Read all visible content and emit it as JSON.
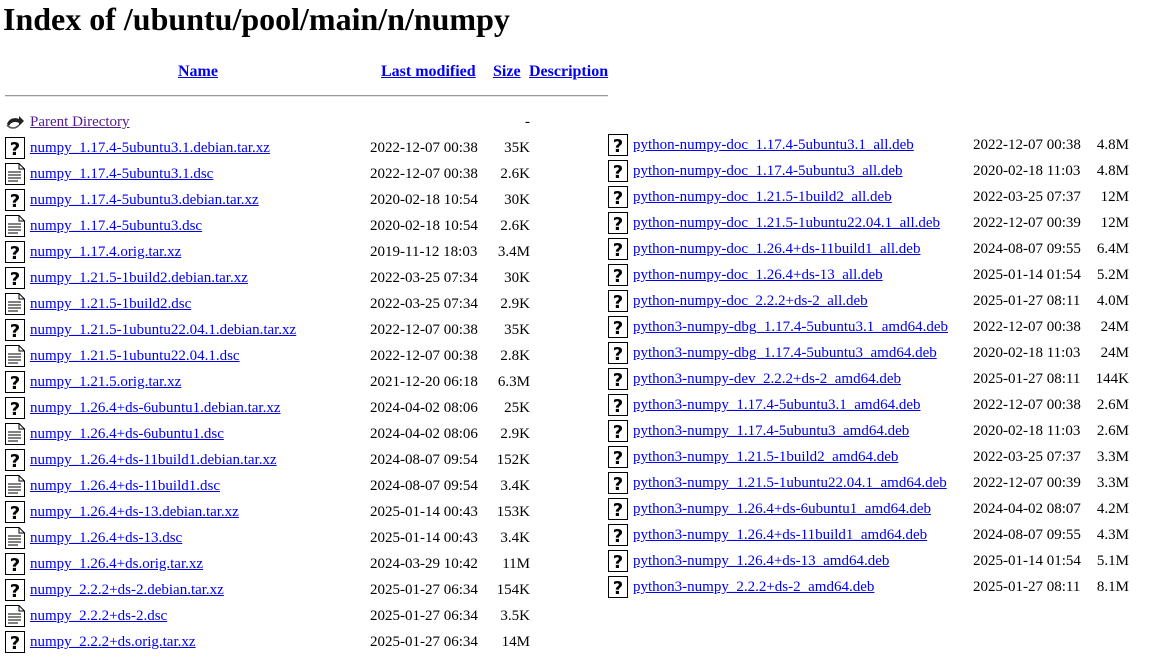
{
  "page": {
    "title": "Index of /ubuntu/pool/main/n/numpy",
    "columns": {
      "name": "Name",
      "last_modified": "Last modified",
      "size": "Size",
      "description": "Description"
    }
  },
  "parent": {
    "label": "Parent Directory",
    "size": "-",
    "icon": "back-arrow-icon"
  },
  "files_left": [
    {
      "name": "numpy_1.17.4-5ubuntu3.1.debian.tar.xz",
      "modified": "2022-12-07 00:38",
      "size": "35K",
      "icon": "unknown-icon"
    },
    {
      "name": "numpy_1.17.4-5ubuntu3.1.dsc",
      "modified": "2022-12-07 00:38",
      "size": "2.6K",
      "icon": "text-file-icon"
    },
    {
      "name": "numpy_1.17.4-5ubuntu3.debian.tar.xz",
      "modified": "2020-02-18 10:54",
      "size": "30K",
      "icon": "unknown-icon"
    },
    {
      "name": "numpy_1.17.4-5ubuntu3.dsc",
      "modified": "2020-02-18 10:54",
      "size": "2.6K",
      "icon": "text-file-icon"
    },
    {
      "name": "numpy_1.17.4.orig.tar.xz",
      "modified": "2019-11-12 18:03",
      "size": "3.4M",
      "icon": "unknown-icon"
    },
    {
      "name": "numpy_1.21.5-1build2.debian.tar.xz",
      "modified": "2022-03-25 07:34",
      "size": "30K",
      "icon": "unknown-icon"
    },
    {
      "name": "numpy_1.21.5-1build2.dsc",
      "modified": "2022-03-25 07:34",
      "size": "2.9K",
      "icon": "text-file-icon"
    },
    {
      "name": "numpy_1.21.5-1ubuntu22.04.1.debian.tar.xz",
      "modified": "2022-12-07 00:38",
      "size": "35K",
      "icon": "unknown-icon"
    },
    {
      "name": "numpy_1.21.5-1ubuntu22.04.1.dsc",
      "modified": "2022-12-07 00:38",
      "size": "2.8K",
      "icon": "text-file-icon"
    },
    {
      "name": "numpy_1.21.5.orig.tar.xz",
      "modified": "2021-12-20 06:18",
      "size": "6.3M",
      "icon": "unknown-icon"
    },
    {
      "name": "numpy_1.26.4+ds-6ubuntu1.debian.tar.xz",
      "modified": "2024-04-02 08:06",
      "size": "25K",
      "icon": "unknown-icon"
    },
    {
      "name": "numpy_1.26.4+ds-6ubuntu1.dsc",
      "modified": "2024-04-02 08:06",
      "size": "2.9K",
      "icon": "text-file-icon"
    },
    {
      "name": "numpy_1.26.4+ds-11build1.debian.tar.xz",
      "modified": "2024-08-07 09:54",
      "size": "152K",
      "icon": "unknown-icon"
    },
    {
      "name": "numpy_1.26.4+ds-11build1.dsc",
      "modified": "2024-08-07 09:54",
      "size": "3.4K",
      "icon": "text-file-icon"
    },
    {
      "name": "numpy_1.26.4+ds-13.debian.tar.xz",
      "modified": "2025-01-14 00:43",
      "size": "153K",
      "icon": "unknown-icon"
    },
    {
      "name": "numpy_1.26.4+ds-13.dsc",
      "modified": "2025-01-14 00:43",
      "size": "3.4K",
      "icon": "text-file-icon"
    },
    {
      "name": "numpy_1.26.4+ds.orig.tar.xz",
      "modified": "2024-03-29 10:42",
      "size": "11M",
      "icon": "unknown-icon"
    },
    {
      "name": "numpy_2.2.2+ds-2.debian.tar.xz",
      "modified": "2025-01-27 06:34",
      "size": "154K",
      "icon": "unknown-icon"
    },
    {
      "name": "numpy_2.2.2+ds-2.dsc",
      "modified": "2025-01-27 06:34",
      "size": "3.5K",
      "icon": "text-file-icon"
    },
    {
      "name": "numpy_2.2.2+ds.orig.tar.xz",
      "modified": "2025-01-27 06:34",
      "size": "14M",
      "icon": "unknown-icon"
    }
  ],
  "files_right": [
    {
      "name": "python-numpy-doc_1.17.4-5ubuntu3.1_all.deb",
      "modified": "2022-12-07 00:38",
      "size": "4.8M",
      "icon": "unknown-icon"
    },
    {
      "name": "python-numpy-doc_1.17.4-5ubuntu3_all.deb",
      "modified": "2020-02-18 11:03",
      "size": "4.8M",
      "icon": "unknown-icon"
    },
    {
      "name": "python-numpy-doc_1.21.5-1build2_all.deb",
      "modified": "2022-03-25 07:37",
      "size": "12M",
      "icon": "unknown-icon"
    },
    {
      "name": "python-numpy-doc_1.21.5-1ubuntu22.04.1_all.deb",
      "modified": "2022-12-07 00:39",
      "size": "12M",
      "icon": "unknown-icon"
    },
    {
      "name": "python-numpy-doc_1.26.4+ds-11build1_all.deb",
      "modified": "2024-08-07 09:55",
      "size": "6.4M",
      "icon": "unknown-icon"
    },
    {
      "name": "python-numpy-doc_1.26.4+ds-13_all.deb",
      "modified": "2025-01-14 01:54",
      "size": "5.2M",
      "icon": "unknown-icon"
    },
    {
      "name": "python-numpy-doc_2.2.2+ds-2_all.deb",
      "modified": "2025-01-27 08:11",
      "size": "4.0M",
      "icon": "unknown-icon"
    },
    {
      "name": "python3-numpy-dbg_1.17.4-5ubuntu3.1_amd64.deb",
      "modified": "2022-12-07 00:38",
      "size": "24M",
      "icon": "unknown-icon"
    },
    {
      "name": "python3-numpy-dbg_1.17.4-5ubuntu3_amd64.deb",
      "modified": "2020-02-18 11:03",
      "size": "24M",
      "icon": "unknown-icon"
    },
    {
      "name": "python3-numpy-dev_2.2.2+ds-2_amd64.deb",
      "modified": "2025-01-27 08:11",
      "size": "144K",
      "icon": "unknown-icon"
    },
    {
      "name": "python3-numpy_1.17.4-5ubuntu3.1_amd64.deb",
      "modified": "2022-12-07 00:38",
      "size": "2.6M",
      "icon": "unknown-icon"
    },
    {
      "name": "python3-numpy_1.17.4-5ubuntu3_amd64.deb",
      "modified": "2020-02-18 11:03",
      "size": "2.6M",
      "icon": "unknown-icon"
    },
    {
      "name": "python3-numpy_1.21.5-1build2_amd64.deb",
      "modified": "2022-03-25 07:37",
      "size": "3.3M",
      "icon": "unknown-icon"
    },
    {
      "name": "python3-numpy_1.21.5-1ubuntu22.04.1_amd64.deb",
      "modified": "2022-12-07 00:39",
      "size": "3.3M",
      "icon": "unknown-icon"
    },
    {
      "name": "python3-numpy_1.26.4+ds-6ubuntu1_amd64.deb",
      "modified": "2024-04-02 08:07",
      "size": "4.2M",
      "icon": "unknown-icon"
    },
    {
      "name": "python3-numpy_1.26.4+ds-11build1_amd64.deb",
      "modified": "2024-08-07 09:55",
      "size": "4.3M",
      "icon": "unknown-icon"
    },
    {
      "name": "python3-numpy_1.26.4+ds-13_amd64.deb",
      "modified": "2025-01-14 01:54",
      "size": "5.1M",
      "icon": "unknown-icon"
    },
    {
      "name": "python3-numpy_2.2.2+ds-2_amd64.deb",
      "modified": "2025-01-27 08:11",
      "size": "8.1M",
      "icon": "unknown-icon"
    }
  ]
}
